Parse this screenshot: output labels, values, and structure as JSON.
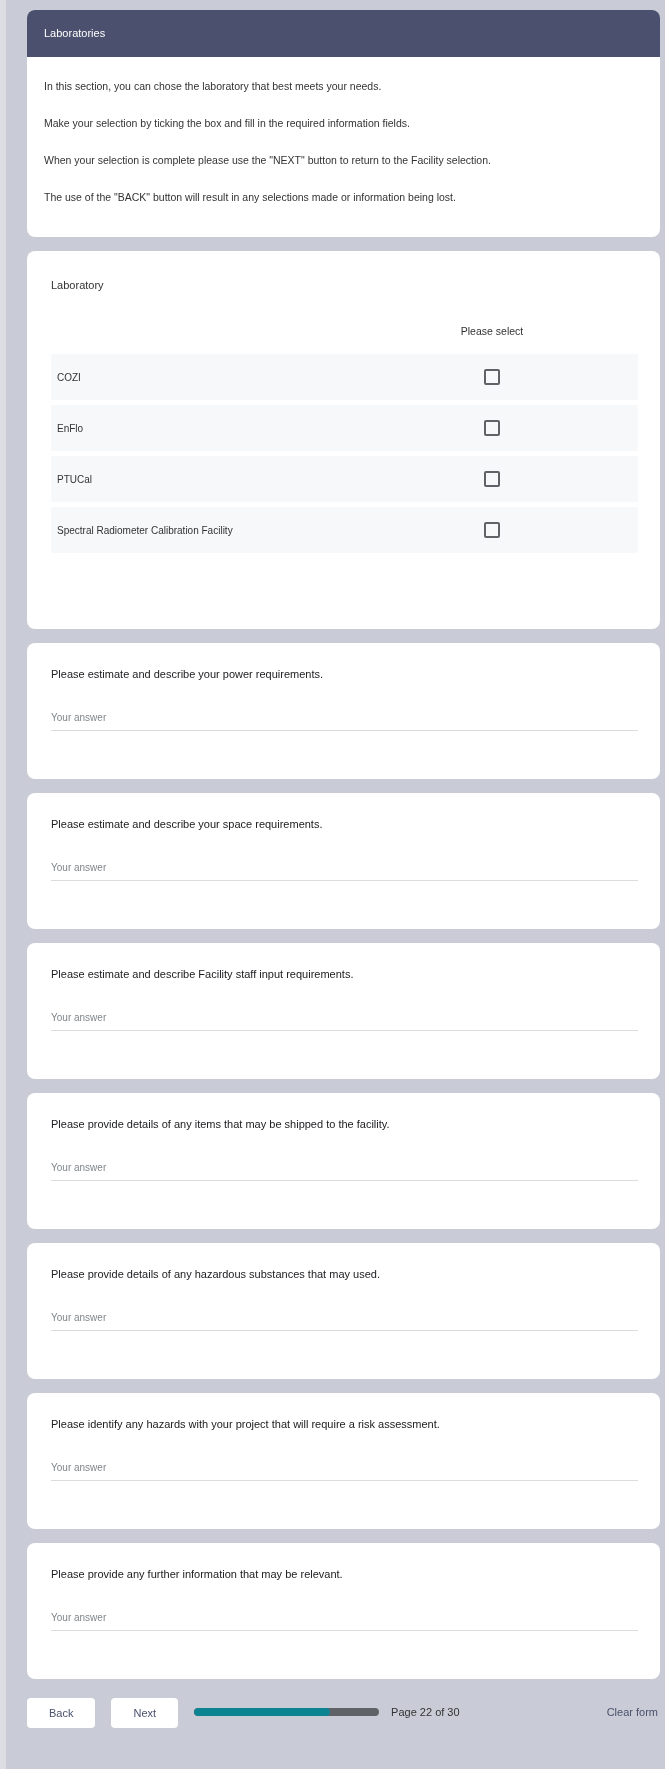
{
  "section": {
    "title": "Laboratories",
    "paragraphs": [
      "In this section, you can chose the laboratory that best meets your needs.",
      "Make your selection by ticking the box and fill in the required information fields.",
      "When your selection is complete please use the \"NEXT\" button to return to the Facility selection.",
      "The use of the \"BACK\" button will result in any selections made or information being lost."
    ]
  },
  "laboratory": {
    "title": "Laboratory",
    "column_header": "Please select",
    "rows": [
      {
        "name": "COZI",
        "checked": false
      },
      {
        "name": "EnFlo",
        "checked": false
      },
      {
        "name": "PTUCal",
        "checked": false
      },
      {
        "name": "Spectral Radiometer Calibration Facility",
        "checked": false
      }
    ]
  },
  "questions": [
    {
      "label": "Please estimate and describe your power requirements.",
      "placeholder": "Your answer"
    },
    {
      "label": "Please estimate and describe your space requirements.",
      "placeholder": "Your answer"
    },
    {
      "label": "Please estimate and describe Facility staff input requirements.",
      "placeholder": "Your answer"
    },
    {
      "label": "Please provide details of any items that may be shipped to the facility.",
      "placeholder": "Your answer"
    },
    {
      "label": "Please provide details of any hazardous substances that may used.",
      "placeholder": "Your answer"
    },
    {
      "label": "Please identify any hazards with your project that will require a risk assessment.",
      "placeholder": "Your answer"
    },
    {
      "label": "Please provide any further information that may be relevant.",
      "placeholder": "Your answer"
    }
  ],
  "footer": {
    "back": "Back",
    "next": "Next",
    "progress": {
      "level": 0.733
    },
    "page": "Page 22 of 30",
    "clear": "Clear form"
  }
}
